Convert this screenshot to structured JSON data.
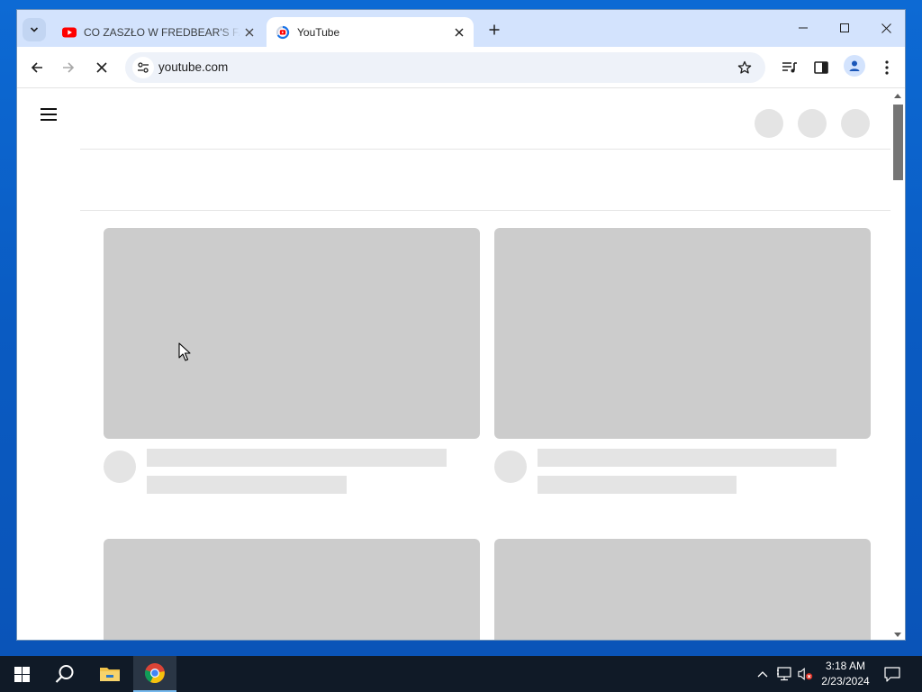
{
  "browser": {
    "tabs": [
      {
        "title": "CO ZASZŁO W FREDBEAR'S FAMILY DINER",
        "favicon": "youtube-icon",
        "active": false
      },
      {
        "title": "YouTube",
        "favicon": "loading-spinner-icon",
        "active": true
      }
    ],
    "omnibox": {
      "url": "youtube.com"
    },
    "navigation": {
      "back": "back-arrow-icon",
      "forward": "forward-arrow-icon",
      "stop": "stop-loading-icon"
    }
  },
  "page": {
    "state": "loading",
    "skeleton_rows": 2,
    "skeleton_columns": 2
  },
  "taskbar": {
    "clock": {
      "time": "3:18 AM",
      "date": "2/23/2024"
    },
    "pinned": [
      "start-icon",
      "search-icon",
      "file-explorer-icon",
      "chrome-icon"
    ]
  },
  "colors": {
    "tabstrip": "#d3e3fd",
    "taskbar": "#101a27",
    "skeleton_thumb": "#cccccc",
    "skeleton_line": "#e4e4e4",
    "youtube_red": "#ff0000"
  }
}
